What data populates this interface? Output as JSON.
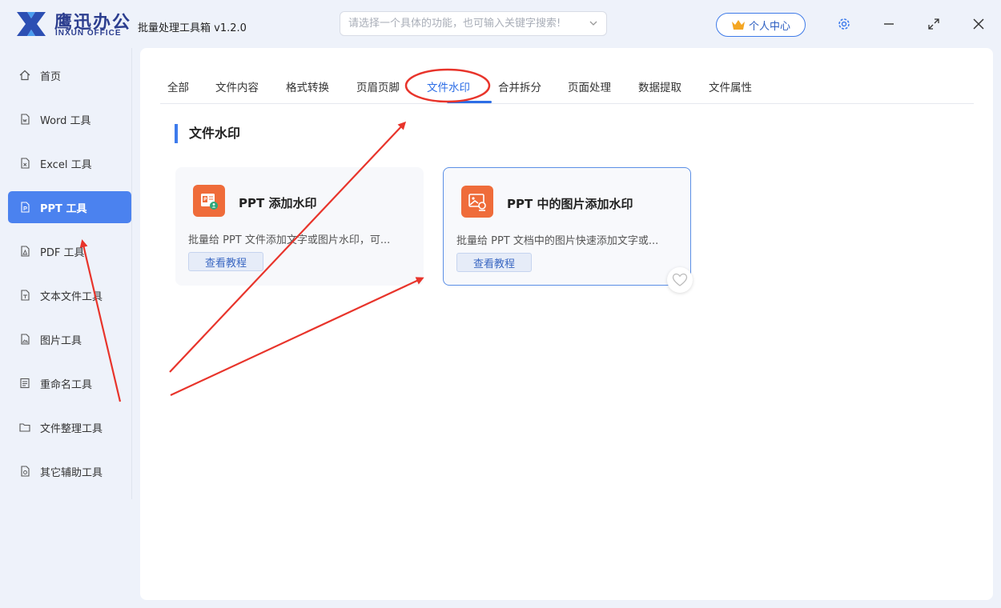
{
  "app": {
    "brand_cn": "鹰迅办公",
    "brand_en": "INXUN OFFICE",
    "title": "批量处理工具箱 v1.2.0"
  },
  "search": {
    "placeholder": "请选择一个具体的功能，也可输入关键字搜索!"
  },
  "header": {
    "user_center": "个人中心",
    "icons": [
      "crown-icon",
      "gear-icon",
      "minimize-icon",
      "maximize-icon",
      "close-icon"
    ]
  },
  "sidebar": {
    "items": [
      {
        "label": "首页",
        "icon": "home-icon"
      },
      {
        "label": "Word 工具",
        "icon": "word-file-icon"
      },
      {
        "label": "Excel 工具",
        "icon": "excel-file-icon"
      },
      {
        "label": "PPT 工具",
        "icon": "ppt-file-icon",
        "active": true
      },
      {
        "label": "PDF 工具",
        "icon": "pdf-file-icon"
      },
      {
        "label": "文本文件工具",
        "icon": "text-file-icon"
      },
      {
        "label": "图片工具",
        "icon": "image-file-icon"
      },
      {
        "label": "重命名工具",
        "icon": "rename-icon"
      },
      {
        "label": "文件整理工具",
        "icon": "folder-icon"
      },
      {
        "label": "其它辅助工具",
        "icon": "tools-icon"
      }
    ]
  },
  "tabs": [
    {
      "label": "全部"
    },
    {
      "label": "文件内容"
    },
    {
      "label": "格式转换"
    },
    {
      "label": "页眉页脚"
    },
    {
      "label": "文件水印",
      "active": true
    },
    {
      "label": "合并拆分"
    },
    {
      "label": "页面处理"
    },
    {
      "label": "数据提取"
    },
    {
      "label": "文件属性"
    }
  ],
  "section": {
    "title": "文件水印"
  },
  "cards": [
    {
      "title": "PPT 添加水印",
      "desc": "批量给 PPT 文件添加文字或图片水印，可...",
      "button": "查看教程",
      "icon": "ppt-watermark-icon"
    },
    {
      "title": "PPT 中的图片添加水印",
      "desc": "批量给 PPT 文档中的图片快速添加文字或...",
      "button": "查看教程",
      "icon": "ppt-image-watermark-icon"
    }
  ],
  "colors": {
    "accent": "#4b82ef",
    "brand": "#2c3e8f",
    "card_icon": "#ef6c3a",
    "annotation": "#e8342b"
  }
}
